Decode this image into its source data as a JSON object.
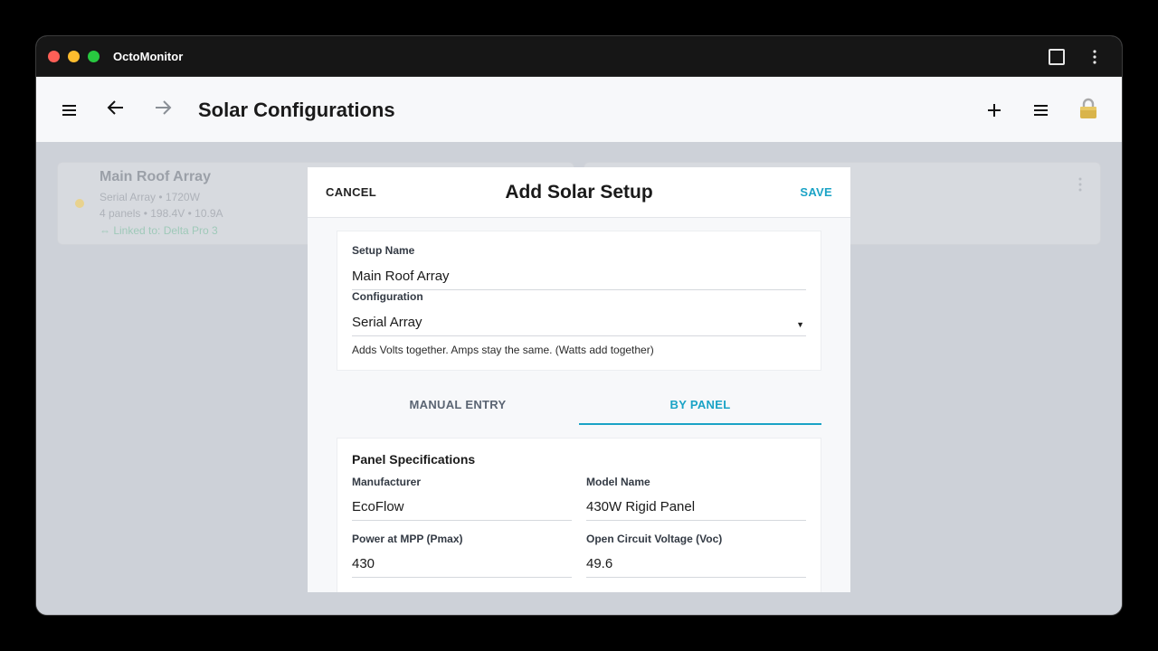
{
  "window": {
    "app_title": "OctoMonitor",
    "controls": [
      "close",
      "minimize",
      "maximize"
    ]
  },
  "appbar": {
    "title": "Solar Configurations",
    "icons": [
      "menu-icon",
      "back-arrow-icon",
      "forward-arrow-icon",
      "add-icon",
      "list-icon",
      "lock-icon"
    ]
  },
  "background_cards": [
    {
      "title": "Main Roof Array",
      "line1": "Serial Array • 1720W",
      "line2": "4 panels • 198.4V • 10.9A",
      "link": "⇔ Linked to: Delta Pro 3"
    },
    {
      "title": "",
      "line1": "",
      "line2": "",
      "link": ""
    }
  ],
  "modal": {
    "cancel_label": "CANCEL",
    "title": "Add Solar Setup",
    "save_label": "SAVE",
    "setup_name": {
      "label": "Setup Name",
      "value": "Main Roof Array"
    },
    "configuration": {
      "label": "Configuration",
      "value": "Serial Array",
      "hint": "Adds Volts together. Amps stay the same. (Watts add together)"
    },
    "tabs": [
      {
        "label": "MANUAL ENTRY",
        "selected": false
      },
      {
        "label": "BY PANEL",
        "selected": true
      }
    ],
    "panel_specs": {
      "title": "Panel Specifications",
      "manufacturer": {
        "label": "Manufacturer",
        "value": "EcoFlow"
      },
      "model_name": {
        "label": "Model Name",
        "value": "430W Rigid Panel"
      },
      "pmax": {
        "label": "Power at MPP (Pmax)",
        "value": "430"
      },
      "voc": {
        "label": "Open Circuit Voltage (Voc)",
        "value": "49.6"
      }
    }
  },
  "colors": {
    "accent": "#1aa3c6",
    "titlebar": "#161616",
    "overlay": "#cdd1d8"
  }
}
